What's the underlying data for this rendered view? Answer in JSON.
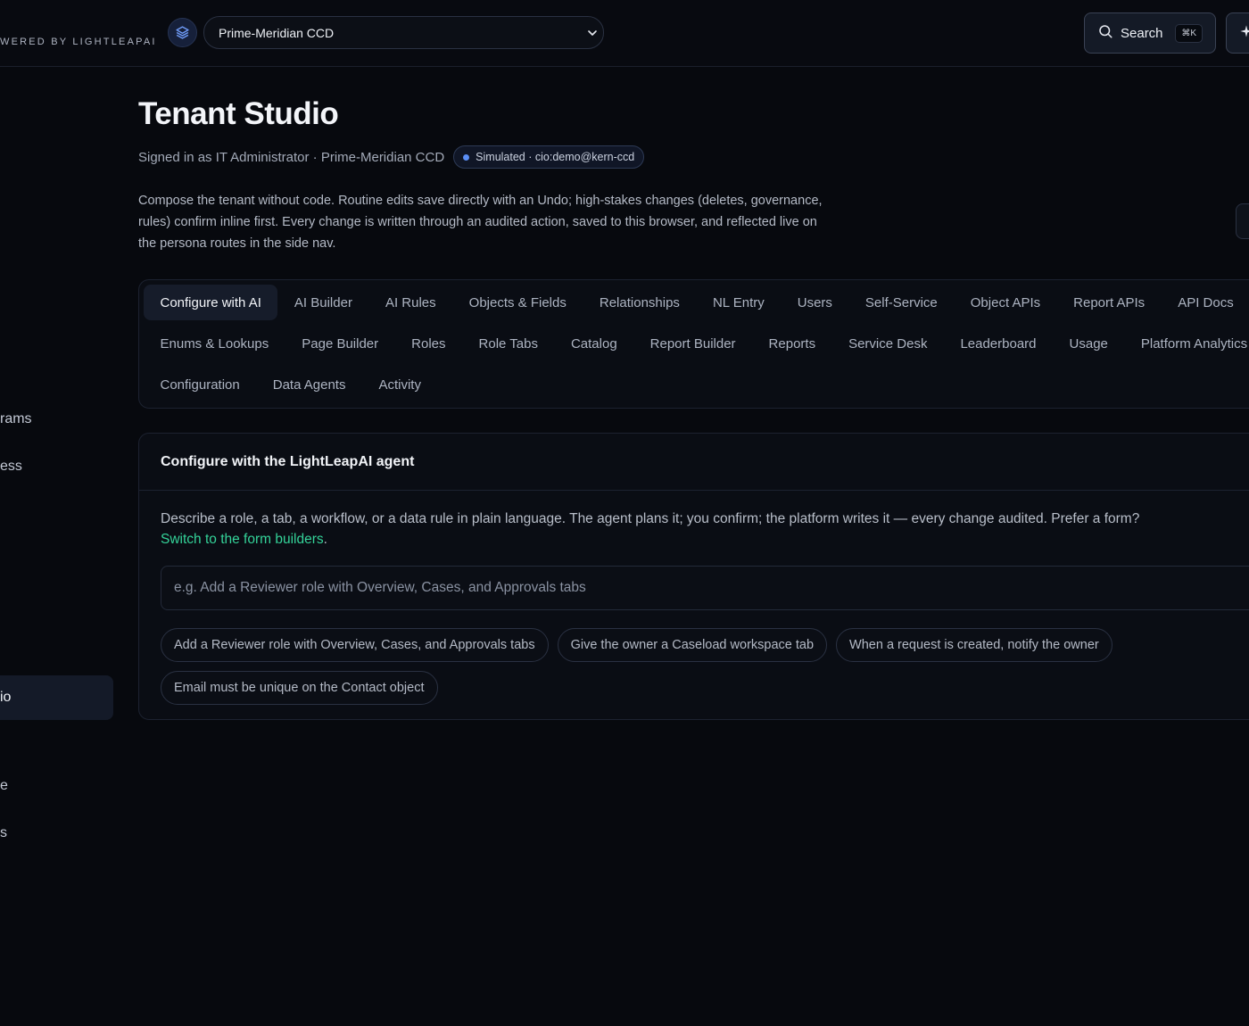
{
  "topbar": {
    "brand": "WERED BY LIGHTLEAPAI",
    "tenant": "Prime-Meridian CCD",
    "search_label": "Search",
    "search_kbd": "⌘K",
    "logo_icon": "layers-icon",
    "extra_icon": "sparkle-icon"
  },
  "sidebar": {
    "items": [
      "rams",
      "ess",
      "io",
      "e",
      "s"
    ]
  },
  "header": {
    "title": "Tenant Studio",
    "signed_in": "Signed in as IT Administrator · Prime-Meridian CCD",
    "badge": "Simulated · cio:demo@kern-ccd",
    "description": "Compose the tenant without code. Routine edits save directly with an Undo; high-stakes changes (deletes, governance, rules) confirm inline first. Every change is written through an audited action, saved to this browser, and reflected live on the persona routes in the side nav."
  },
  "tabs": {
    "row1": [
      "Configure with AI",
      "AI Builder",
      "AI Rules",
      "Objects & Fields",
      "Relationships",
      "NL Entry",
      "Users",
      "Self-Service",
      "Object APIs",
      "Report APIs",
      "API Docs"
    ],
    "row2": [
      "Enums & Lookups",
      "Page Builder",
      "Roles",
      "Role Tabs",
      "Catalog",
      "Report Builder",
      "Reports",
      "Service Desk",
      "Leaderboard",
      "Usage",
      "Platform Analytics"
    ],
    "row3": [
      "Configuration",
      "Data Agents",
      "Activity"
    ],
    "active": "Configure with AI"
  },
  "agent": {
    "title": "Configure with the LightLeapAI agent",
    "text": "Describe a role, a tab, a workflow, or a data rule in plain language. The agent plans it; you confirm; the platform writes it — every change audited. Prefer a form?",
    "link": "Switch to the form builders",
    "link_suffix": ".",
    "placeholder": "e.g. Add a Reviewer role with Overview, Cases, and Approvals tabs",
    "suggestions": [
      "Add a Reviewer role with Overview, Cases, and Approvals tabs",
      "Give the owner a Caseload workspace tab",
      "When a request is created, notify the owner",
      "Email must be unique on the Contact object"
    ]
  },
  "colors": {
    "background": "#07090e",
    "accent_link": "#34d399",
    "badge_dot": "#5b8ef5"
  }
}
